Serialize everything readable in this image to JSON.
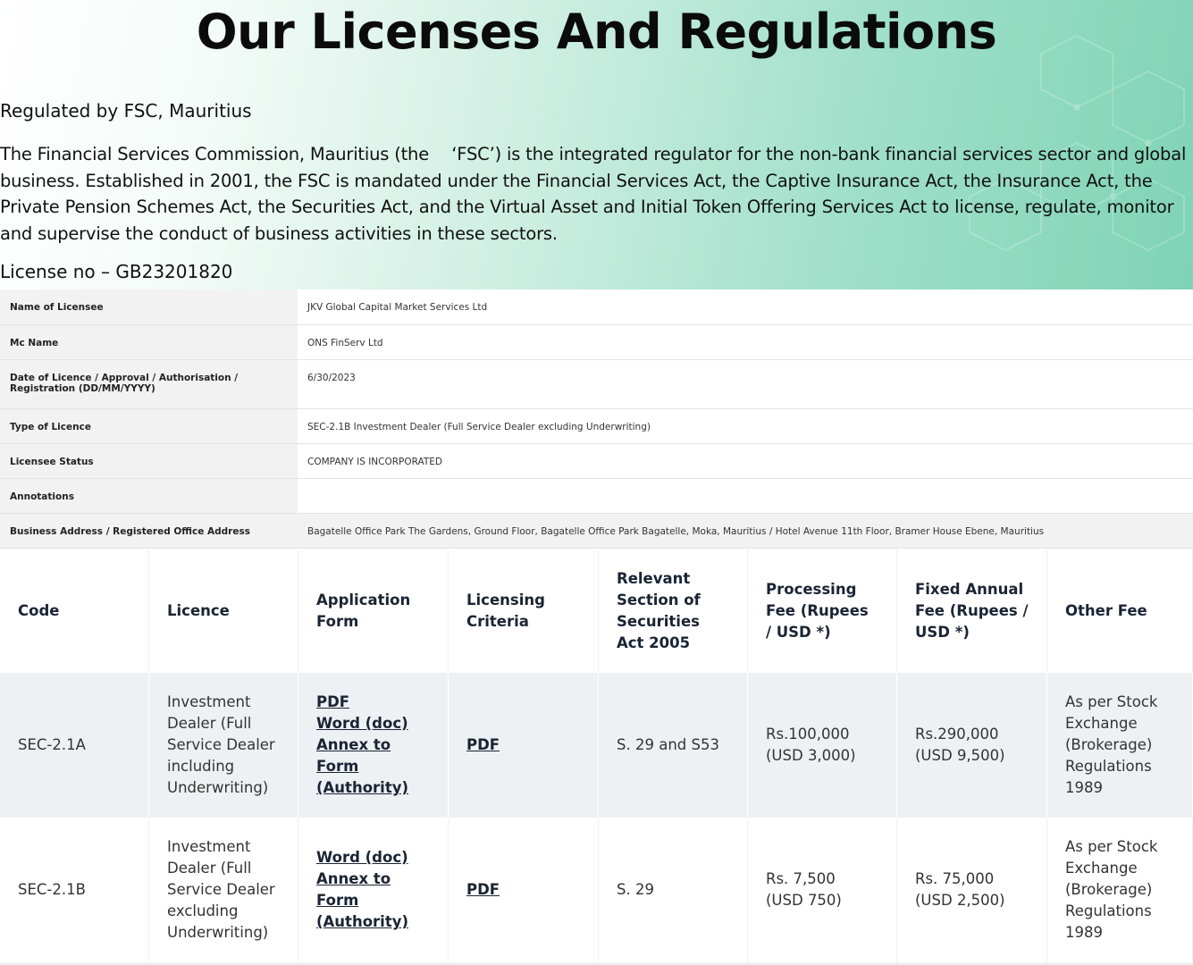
{
  "page": {
    "title": "Our Licenses And Regulations",
    "regulated_by": "Regulated by FSC, Mauritius",
    "intro": "The Financial Services Commission, Mauritius (the 　‘FSC’) is the integrated regulator for the non-bank financial services sector and global business. Established in 2001, the FSC is mandated under the Financial Services Act, the Captive Insurance Act, the Insurance Act, the Private Pension Schemes Act, the Securities Act, and the Virtual Asset and Initial Token Offering Services Act to license, regulate, monitor and supervise the conduct of business activities in these sectors.",
    "license_no": "License no – GB23201820"
  },
  "licensee": [
    {
      "label": "Name of Licensee",
      "value": "JKV Global Capital Market Services Ltd"
    },
    {
      "label": "Mc Name",
      "value": "ONS FinServ Ltd"
    },
    {
      "label": "Date of Licence / Approval / Authorisation / Registration (DD/MM/YYYY)",
      "value": "6/30/2023"
    },
    {
      "label": "Type of Licence",
      "value": "SEC-2.1B Investment Dealer (Full Service Dealer excluding Underwriting)"
    },
    {
      "label": "Licensee Status",
      "value": "COMPANY IS INCORPORATED"
    },
    {
      "label": "Annotations",
      "value": ""
    },
    {
      "label": "Business Address / Registered Office Address",
      "value": "Bagatelle Office Park The Gardens, Ground Floor, Bagatelle Office Park Bagatelle, Moka, Mauritius / Hotel Avenue 11th Floor, Bramer House Ebene, Mauritius"
    }
  ],
  "fees_table": {
    "headers": [
      "Code",
      "Licence",
      "Application Form",
      "Licensing Criteria",
      "Relevant Section of Securities Act 2005",
      "Processing Fee (Rupees / USD *)",
      "Fixed Annual Fee (Rupees / USD *)",
      "Other Fee"
    ],
    "rows": [
      {
        "code": "SEC-2.1A",
        "licence": "Investment Dealer (Full Service Dealer including Underwriting)",
        "form_links": [
          "PDF",
          "Word (doc)",
          "Annex to Form (Authority)"
        ],
        "criteria_link": "PDF",
        "section": "S. 29 and S53",
        "processing_fee": "Rs.100,000",
        "processing_fee_usd": "(USD 3,000)",
        "annual_fee": "Rs.290,000",
        "annual_fee_usd": "(USD 9,500)",
        "other_fee": "As per Stock Exchange (Brokerage) Regulations 1989"
      },
      {
        "code": "SEC-2.1B",
        "licence": "Investment Dealer (Full Service Dealer excluding Underwriting)",
        "form_links": [
          "Word (doc)",
          "Annex to Form (Authority)"
        ],
        "criteria_link": "PDF",
        "section": "S. 29",
        "processing_fee": "Rs. 7,500",
        "processing_fee_usd": "(USD 750)",
        "annual_fee": "Rs. 75,000",
        "annual_fee_usd": "(USD 2,500)",
        "other_fee": "As per Stock Exchange (Brokerage) Regulations 1989"
      }
    ]
  }
}
